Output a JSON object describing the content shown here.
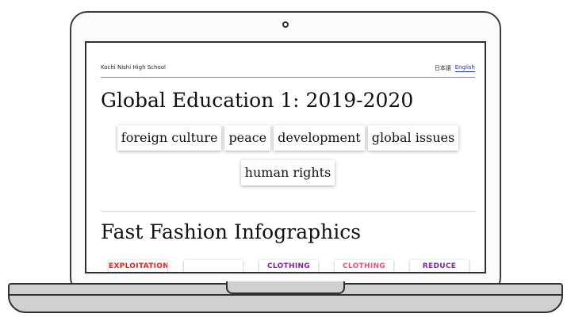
{
  "site": {
    "school_name": "Kochi Nishi High School",
    "lang_ja": "日本語",
    "lang_en": "English"
  },
  "page": {
    "title": "Global Education 1: 2019-2020",
    "tags": [
      "foreign culture",
      "peace",
      "development",
      "global issues",
      "human rights"
    ]
  },
  "section": {
    "title": "Fast Fashion Infographics",
    "thumbnails": [
      {
        "label": "EXPLOITATION",
        "color": "#d9261c"
      },
      {
        "label": "",
        "color": "#333333"
      },
      {
        "label": "CLOTHING",
        "color": "#8a1aa8"
      },
      {
        "label": "CLOTHING",
        "color": "#e0557a"
      },
      {
        "label": "REDUCE",
        "color": "#7a2a9a"
      }
    ]
  },
  "colors": {
    "link": "#1f2fa8",
    "laptop_base": "#d0d0d0"
  }
}
